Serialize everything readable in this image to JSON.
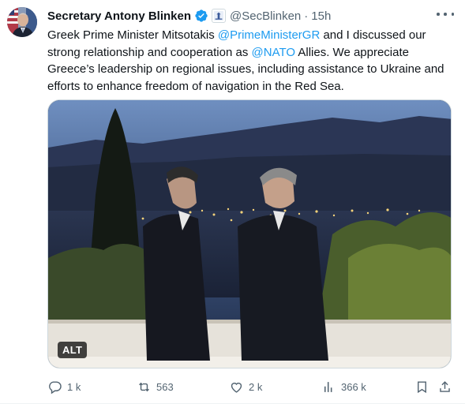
{
  "tweet": {
    "author_name": "Secretary Antony Blinken",
    "handle": "@SecBlinken",
    "separator": "·",
    "time": "15h",
    "text_parts": {
      "p1": "Greek Prime Minister Mitsotakis ",
      "mention1": "@PrimeMinisterGR",
      "p2": " and I discussed our strong relationship and cooperation as ",
      "mention2": "@NATO",
      "p3": " Allies. We appreciate Greece’s leadership on regional issues, including assistance to Ukraine and efforts to enhance freedom of navigation in the Red Sea."
    },
    "media": {
      "alt_badge": "ALT"
    },
    "actions": {
      "replies": "1 k",
      "reposts": "563",
      "likes": "2 k",
      "views": "366 k"
    }
  },
  "colors": {
    "accent": "#1d9bf0",
    "secondary_text": "#536471",
    "verified_badge": "#1d9bf0"
  },
  "icons": {
    "verified": "verified-badge-icon",
    "gov": "us-government-seal-icon",
    "more": "more-icon",
    "reply": "reply-icon",
    "repost": "repost-icon",
    "like": "like-icon",
    "views": "views-icon",
    "bookmark": "bookmark-icon",
    "share": "share-icon"
  }
}
